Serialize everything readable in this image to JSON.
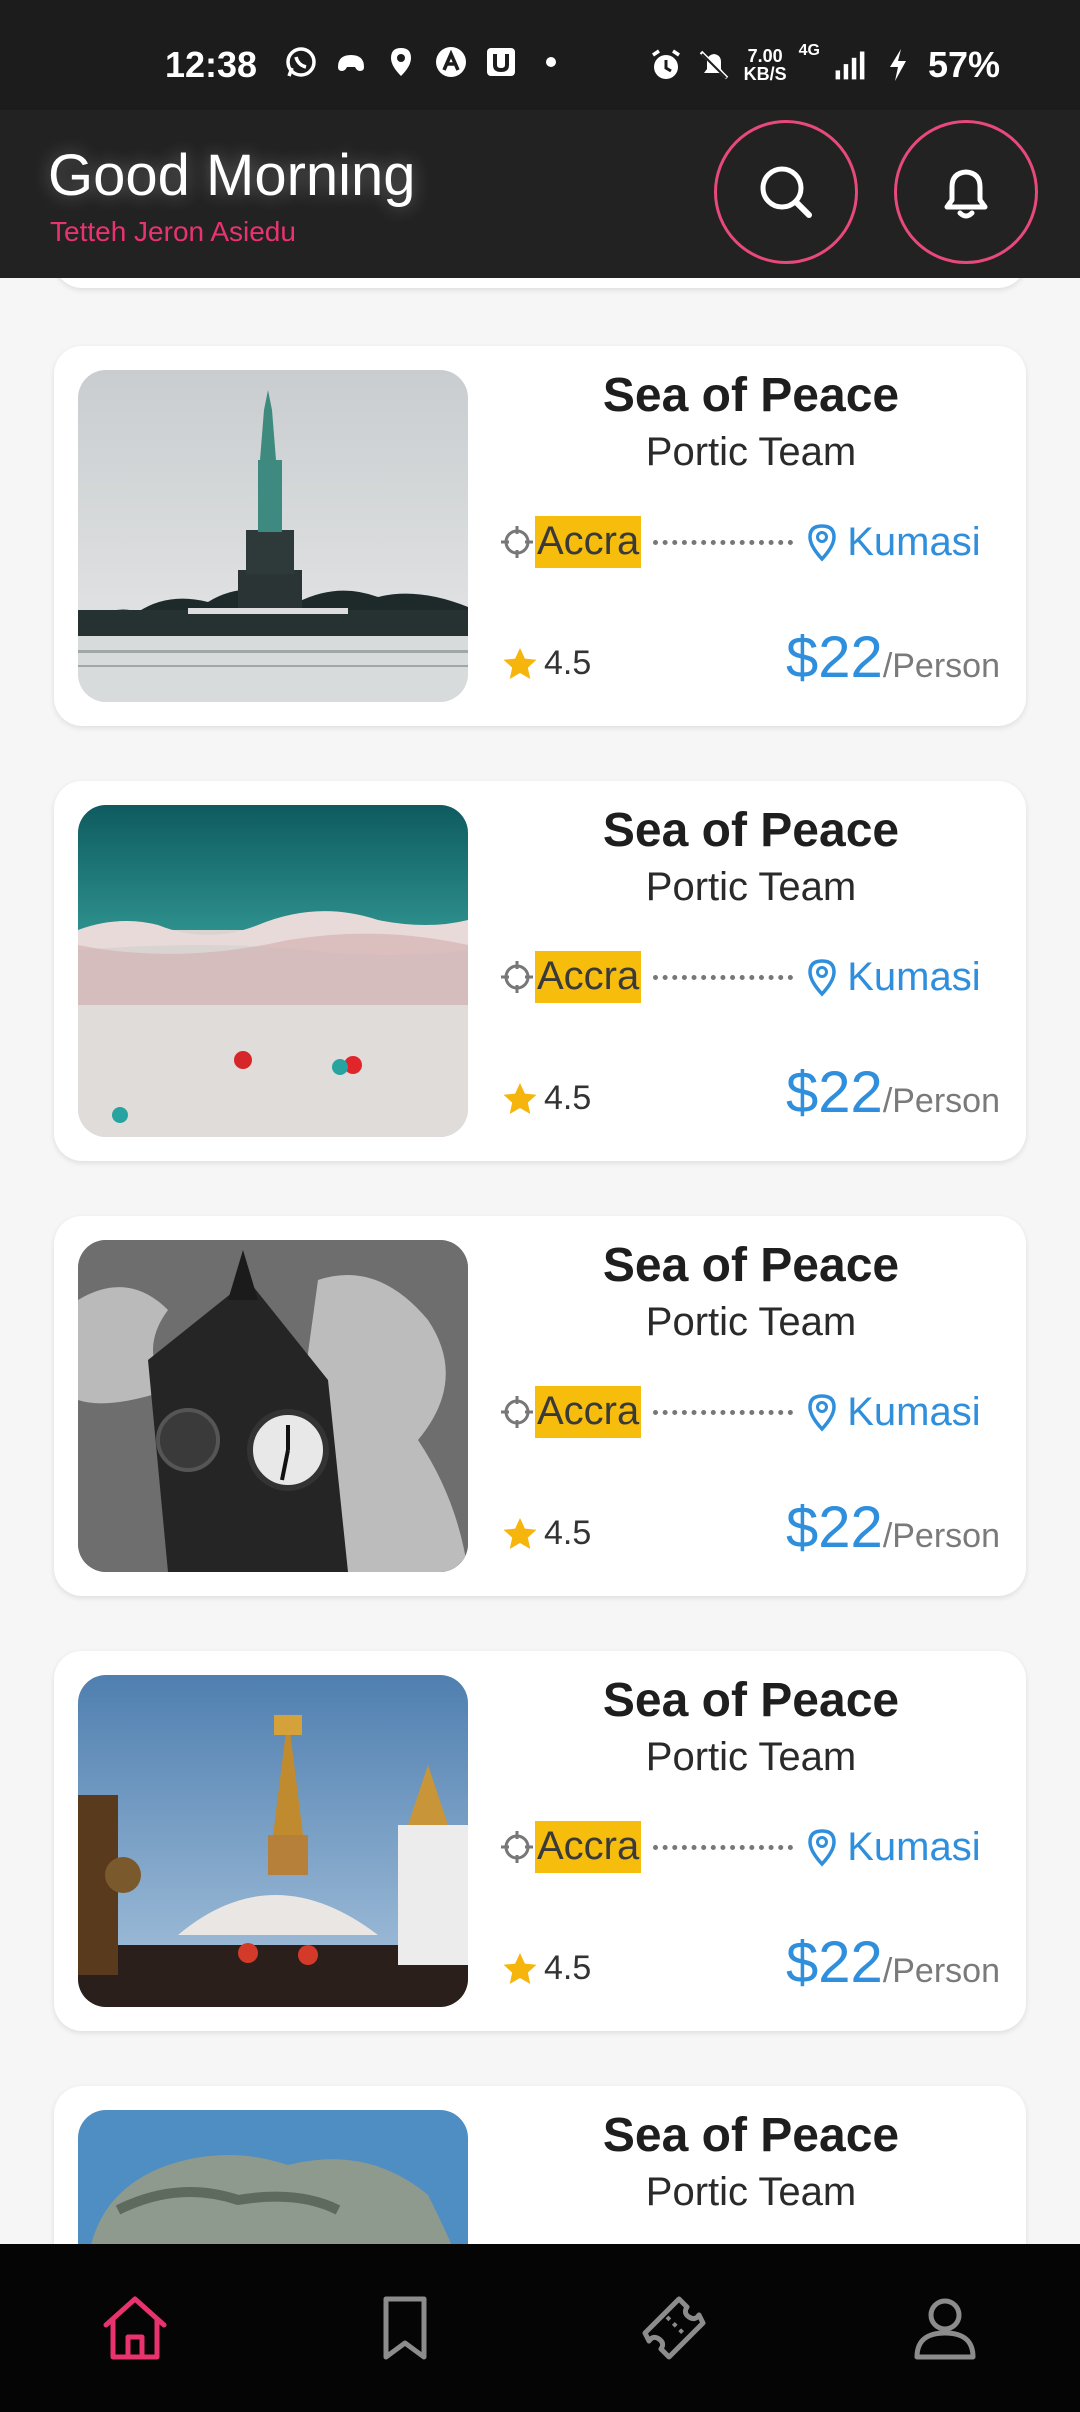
{
  "status_bar": {
    "time": "12:38",
    "net_speed_top": "7.00",
    "net_speed_bottom": "KB/S",
    "network": "4G",
    "battery": "57%"
  },
  "header": {
    "greeting": "Good Morning",
    "user_name": "Tetteh Jeron Asiedu"
  },
  "trips": [
    {
      "title": "Sea of Peace",
      "team": "Portic Team",
      "from": "Accra",
      "to": "Kumasi",
      "rating": "4.5",
      "price": "$22",
      "unit": "/Person",
      "image": "statue-of-liberty"
    },
    {
      "title": "Sea of Peace",
      "team": "Portic Team",
      "from": "Accra",
      "to": "Kumasi",
      "rating": "4.5",
      "price": "$22",
      "unit": "/Person",
      "image": "beach-aerial"
    },
    {
      "title": "Sea of Peace",
      "team": "Portic Team",
      "from": "Accra",
      "to": "Kumasi",
      "rating": "4.5",
      "price": "$22",
      "unit": "/Person",
      "image": "big-ben"
    },
    {
      "title": "Sea of Peace",
      "team": "Portic Team",
      "from": "Accra",
      "to": "Kumasi",
      "rating": "4.5",
      "price": "$22",
      "unit": "/Person",
      "image": "stupa-temple"
    },
    {
      "title": "Sea of Peace",
      "team": "Portic Team",
      "image": "sea-rock"
    }
  ],
  "colors": {
    "accent_pink": "#e8336f",
    "price_blue": "#2f8fdc",
    "origin_highlight": "#f7bd0c",
    "header_bg": "#222223"
  },
  "nav": {
    "items": [
      "home-icon",
      "bookmark-icon",
      "ticket-icon",
      "profile-icon"
    ],
    "active": "home-icon"
  }
}
